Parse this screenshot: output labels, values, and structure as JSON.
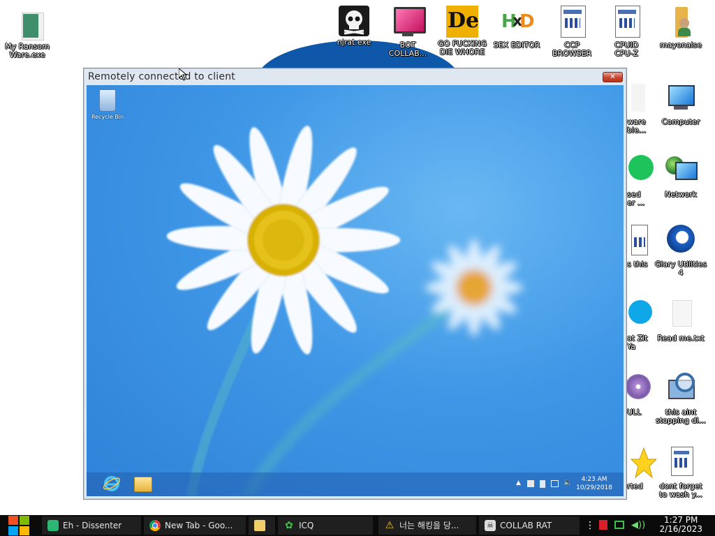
{
  "desktop": {
    "icons": [
      {
        "id": "ransom",
        "label": "My Ransom\nWare.exe"
      },
      {
        "id": "njrat",
        "label": "njrat.exe"
      },
      {
        "id": "bot",
        "label": "BOT\nCOLLAB..."
      },
      {
        "id": "die",
        "label": "GO FUCKING\nDIE WHORE"
      },
      {
        "id": "hxd",
        "label": "SEX EDITOR"
      },
      {
        "id": "ccp",
        "label": "CCP\nBROWSER"
      },
      {
        "id": "cpuid",
        "label": "CPUID\nCPU-Z"
      },
      {
        "id": "mayo",
        "label": "mayonaise"
      },
      {
        "id": "computer",
        "label": "Computer"
      },
      {
        "id": "network",
        "label": "Network"
      },
      {
        "id": "glary",
        "label": "Glary Utilities\n4"
      },
      {
        "id": "readme",
        "label": "Read me.txt"
      },
      {
        "id": "stopping",
        "label": "this aint\nstopping di..."
      },
      {
        "id": "wash",
        "label": "dont forget\nto wash y..."
      }
    ],
    "partial_labels": [
      {
        "id": "p1",
        "label": "ware\nble..."
      },
      {
        "id": "p2",
        "label": "sed\ner ..."
      },
      {
        "id": "p3",
        "label": "s this"
      },
      {
        "id": "p4",
        "label": "at Zit\nYa"
      },
      {
        "id": "p5",
        "label": "ULL"
      },
      {
        "id": "p6",
        "label": "rted"
      }
    ]
  },
  "remote_window": {
    "title": "Remotely connected to client",
    "close_glyph": "✕",
    "recycle_bin_label": "Recycle Bin",
    "tray_time": "4:23 AM",
    "tray_date": "10/29/2018"
  },
  "taskbar": {
    "items": [
      {
        "label": "Eh - Dissenter"
      },
      {
        "label": "New Tab - Goo..."
      },
      {
        "label": ""
      },
      {
        "label": "ICQ"
      },
      {
        "label": "너는 해킹을 당..."
      },
      {
        "label": "COLLAB RAT"
      }
    ],
    "time": "1:27 PM",
    "date": "2/16/2023"
  }
}
